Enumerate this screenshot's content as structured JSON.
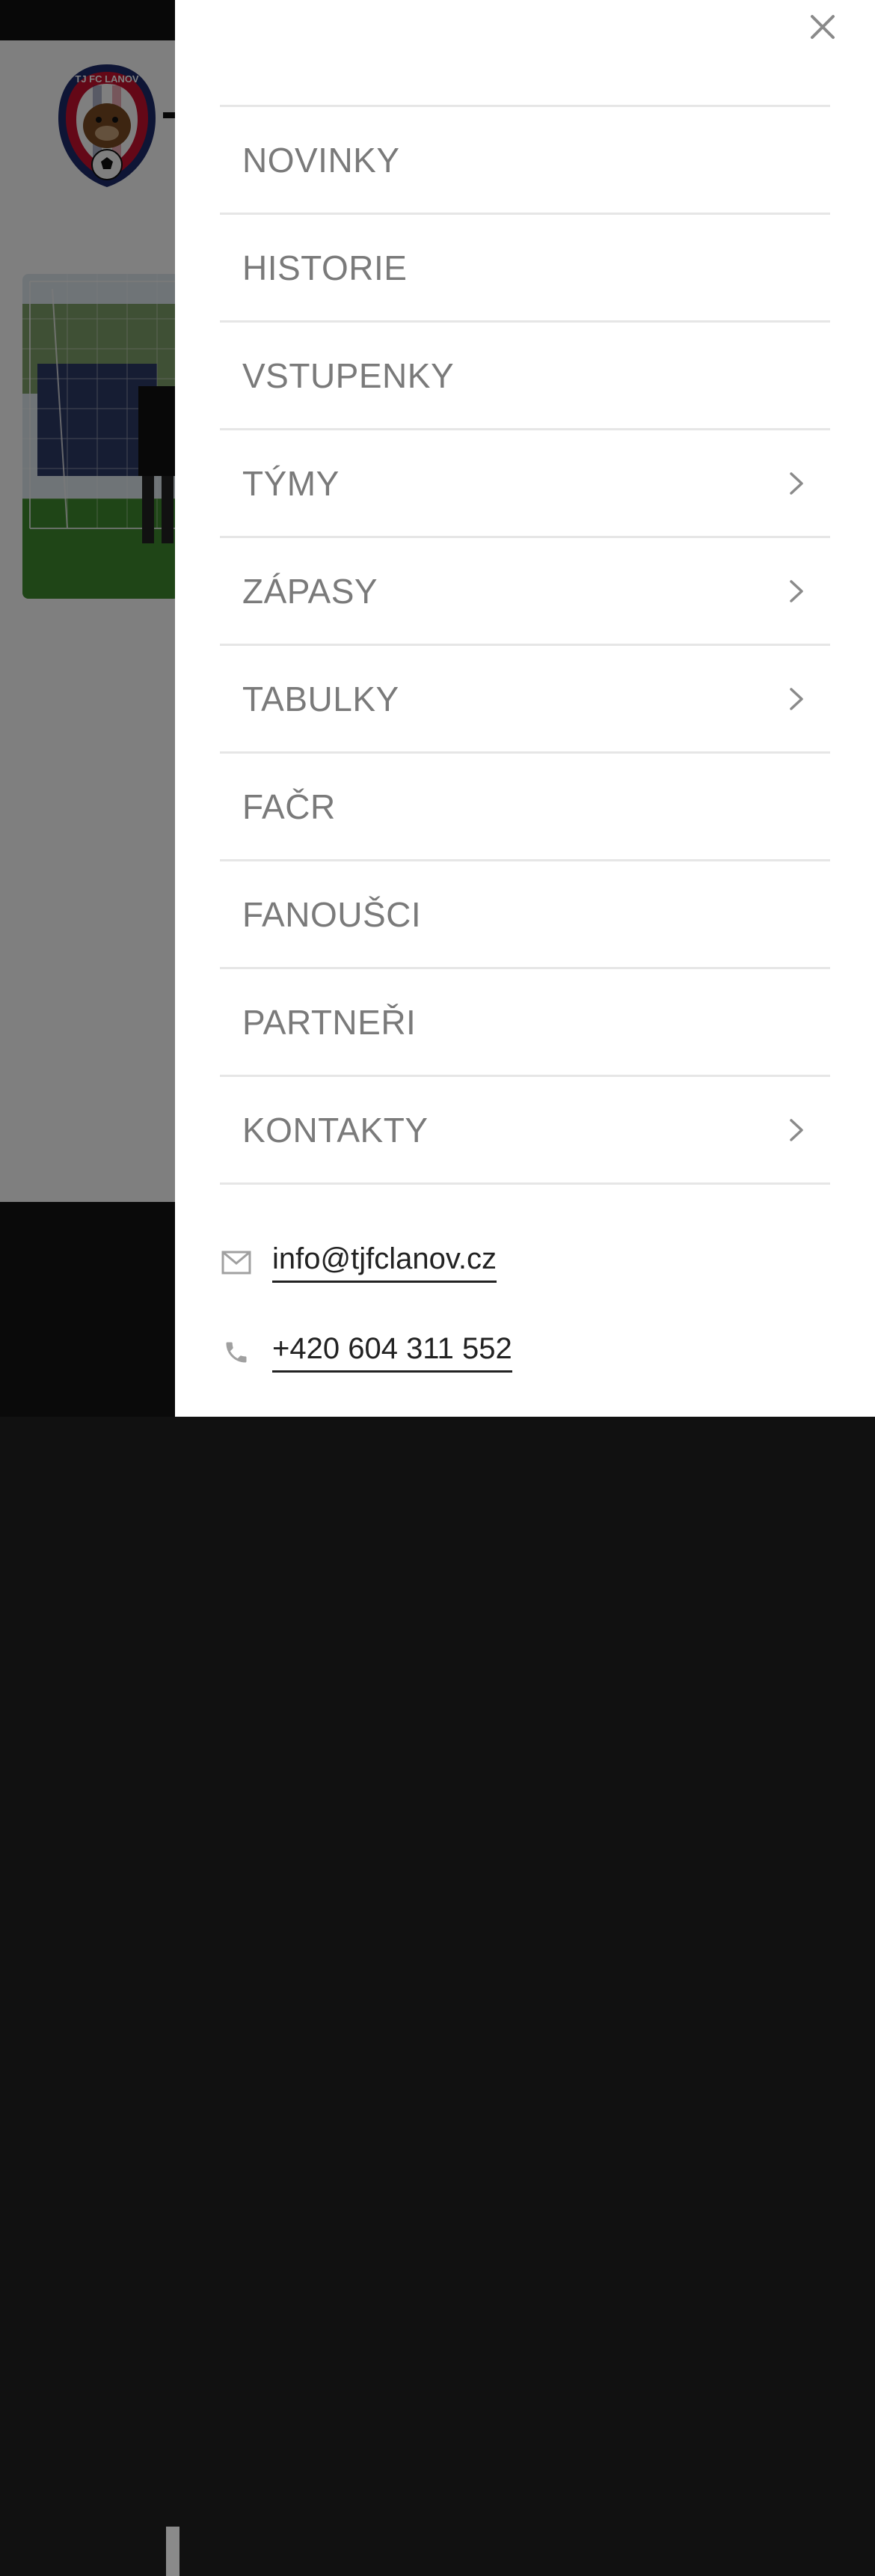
{
  "drawer": {
    "menu_items": [
      {
        "label": "NOVINKY",
        "has_submenu": false
      },
      {
        "label": "HISTORIE",
        "has_submenu": false
      },
      {
        "label": "VSTUPENKY",
        "has_submenu": false
      },
      {
        "label": "TÝMY",
        "has_submenu": true
      },
      {
        "label": "ZÁPASY",
        "has_submenu": true
      },
      {
        "label": "TABULKY",
        "has_submenu": true
      },
      {
        "label": "FAČR",
        "has_submenu": false
      },
      {
        "label": "FANOUŠCI",
        "has_submenu": false
      },
      {
        "label": "PARTNEŘI",
        "has_submenu": false
      },
      {
        "label": "KONTAKTY",
        "has_submenu": true
      }
    ],
    "contact": {
      "email": "info@tjfclanov.cz",
      "phone": "+420 604 311 552"
    }
  },
  "background": {
    "logo_text": "TJ FC LANOV"
  },
  "colors": {
    "menu_text": "#7a7a7a",
    "divider": "#e6e6e6",
    "contact_text": "#222222"
  }
}
